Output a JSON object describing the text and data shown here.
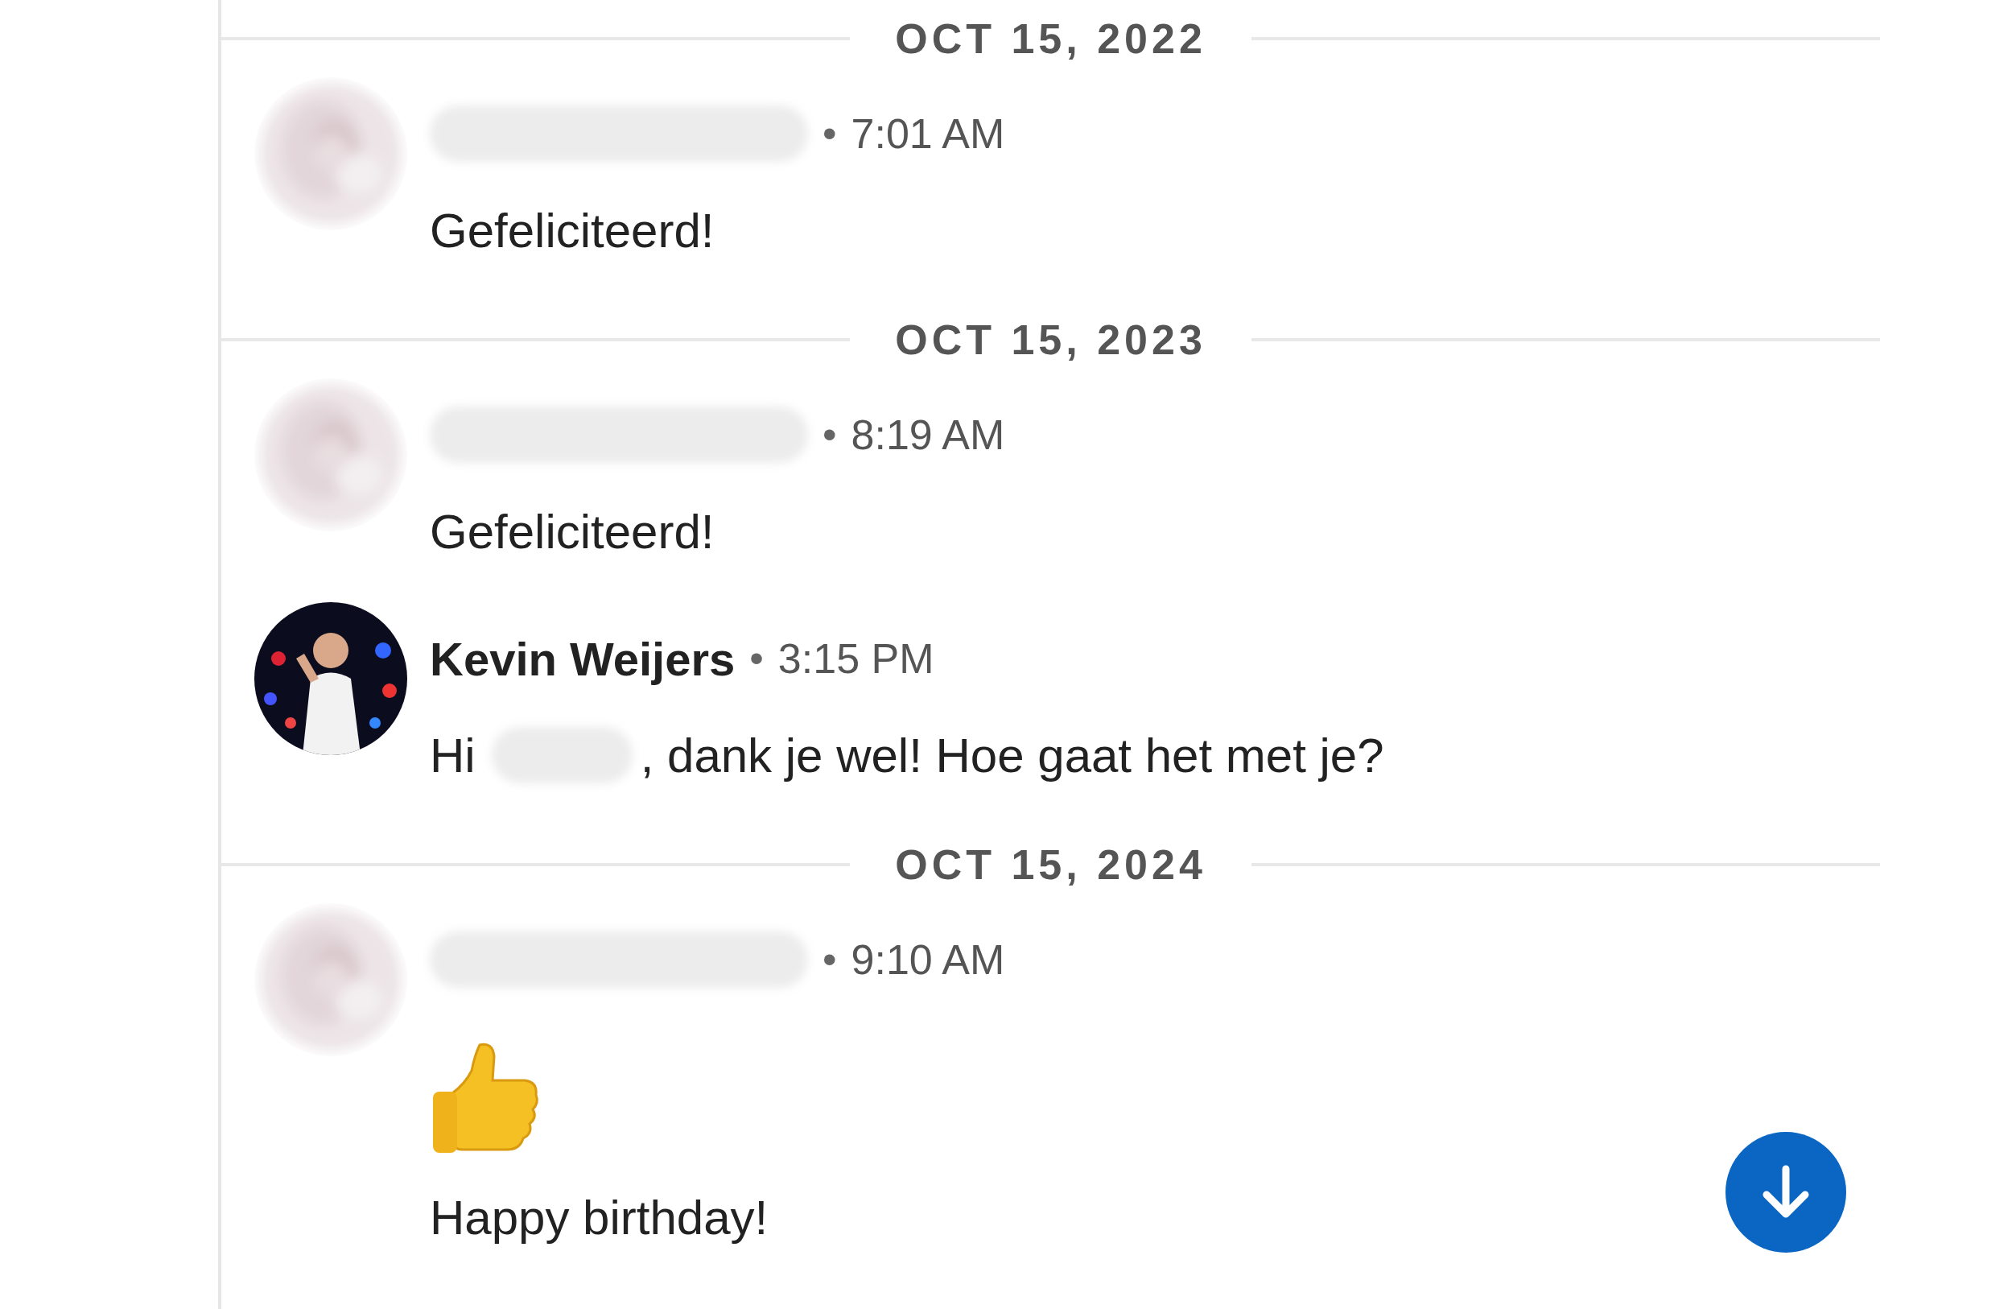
{
  "timeline": [
    {
      "kind": "date",
      "label": "OCT 15, 2022"
    },
    {
      "kind": "message",
      "avatar_blurred": true,
      "sender_redacted": true,
      "separator": "•",
      "time": "7:01 AM",
      "lines": [
        [
          {
            "kind": "text",
            "text": "Gefeliciteerd!"
          }
        ]
      ]
    },
    {
      "kind": "date",
      "label": "OCT 15, 2023"
    },
    {
      "kind": "message",
      "avatar_blurred": true,
      "sender_redacted": true,
      "separator": "•",
      "time": "8:19 AM",
      "lines": [
        [
          {
            "kind": "text",
            "text": "Gefeliciteerd!"
          }
        ]
      ]
    },
    {
      "kind": "message",
      "avatar_blurred": false,
      "sender_redacted": false,
      "sender": "Kevin Weijers",
      "separator": "•",
      "time": "3:15 PM",
      "lines": [
        [
          {
            "kind": "text",
            "text": "Hi"
          },
          {
            "kind": "redacted"
          },
          {
            "kind": "text",
            "text": ", dank je wel! Hoe gaat het met je?"
          }
        ]
      ]
    },
    {
      "kind": "date",
      "label": "OCT 15, 2024"
    },
    {
      "kind": "message",
      "avatar_blurred": true,
      "sender_redacted": true,
      "separator": "•",
      "time": "9:10 AM",
      "lines": [
        [
          {
            "kind": "sticker"
          }
        ],
        [
          {
            "kind": "text",
            "text": "Happy birthday!"
          }
        ]
      ]
    }
  ]
}
